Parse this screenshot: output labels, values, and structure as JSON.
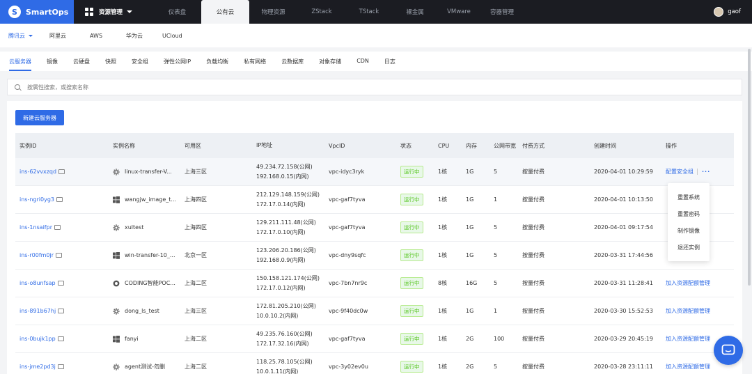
{
  "app": {
    "logo_text": "SmartOps",
    "logo_mark": "S"
  },
  "menu": {
    "label": "资源管理"
  },
  "topnav": [
    "仪表盘",
    "公有云",
    "物理资源",
    "ZStack",
    "TStack",
    "裸金属",
    "VMware",
    "容器管理"
  ],
  "user": {
    "name": "gaof"
  },
  "providers": [
    "腾讯云",
    "阿里云",
    "AWS",
    "华为云",
    "UCloud"
  ],
  "tabs": [
    "云服务器",
    "镜像",
    "云硬盘",
    "快照",
    "安全组",
    "弹性公网IP",
    "负载均衡",
    "私有网络",
    "云数据库",
    "对象存储",
    "CDN",
    "日志"
  ],
  "search": {
    "placeholder": "按属性搜索，或搜索名称"
  },
  "new_button": "新建云服务器",
  "columns": [
    "实例ID",
    "实例名称",
    "可用区",
    "IP地址",
    "VpcID",
    "状态",
    "CPU",
    "内存",
    "公网带宽",
    "付费方式",
    "创建时间",
    "操作"
  ],
  "rows": [
    {
      "id": "ins-62vvxzqd",
      "os": "gear-icon",
      "name": "linux-transfer-V...",
      "zone": "上海三区",
      "ip1": "49.234.72.158(公网)",
      "ip2": "192.168.0.15(内网)",
      "vpc": "vpc-idyc3ryk",
      "status": "运行中",
      "cpu": "1核",
      "mem": "1G",
      "bw": "5",
      "pay": "按量付费",
      "time": "2020-04-01 10:29:59",
      "op": "配置安全组"
    },
    {
      "id": "ins-ngri0yg3",
      "os": "windows-icon",
      "name": "wangjw_image_t...",
      "zone": "上海四区",
      "ip1": "212.129.148.159(公网)",
      "ip2": "172.17.0.14(内网)",
      "vpc": "vpc-gaf7tyva",
      "status": "运行中",
      "cpu": "1核",
      "mem": "1G",
      "bw": "1",
      "pay": "按量付费",
      "time": "2020-04-01 10:13:50",
      "op": ""
    },
    {
      "id": "ins-1nsaifpr",
      "os": "gear-icon",
      "name": "xultest",
      "zone": "上海四区",
      "ip1": "129.211.111.48(公网)",
      "ip2": "172.17.0.10(内网)",
      "vpc": "vpc-gaf7tyva",
      "status": "运行中",
      "cpu": "1核",
      "mem": "1G",
      "bw": "5",
      "pay": "按量付费",
      "time": "2020-04-01 09:17:54",
      "op": ""
    },
    {
      "id": "ins-r00fm0jr",
      "os": "windows-icon",
      "name": "win-transfer-10_...",
      "zone": "北京一区",
      "ip1": "123.206.20.186(公网)",
      "ip2": "192.168.0.9(内网)",
      "vpc": "vpc-dny9sqfc",
      "status": "运行中",
      "cpu": "1核",
      "mem": "1G",
      "bw": "5",
      "pay": "按量付费",
      "time": "2020-03-31 17:44:56",
      "op": ""
    },
    {
      "id": "ins-o8unfsap",
      "os": "coding-icon",
      "name": "CODING智能POC...",
      "zone": "上海二区",
      "ip1": "150.158.121.174(公网)",
      "ip2": "172.17.0.12(内网)",
      "vpc": "vpc-7bn7nr9c",
      "status": "运行中",
      "cpu": "8核",
      "mem": "16G",
      "bw": "5",
      "pay": "按量付费",
      "time": "2020-03-31 11:28:41",
      "op": "加入资源配额管理"
    },
    {
      "id": "ins-891b67hj",
      "os": "gear-icon",
      "name": "dong_ls_test",
      "zone": "上海三区",
      "ip1": "172.81.205.210(公网)",
      "ip2": "10.0.10.2(内网)",
      "vpc": "vpc-9f40dc0w",
      "status": "运行中",
      "cpu": "1核",
      "mem": "1G",
      "bw": "1",
      "pay": "按量付费",
      "time": "2020-03-30 15:52:53",
      "op": "加入资源配额管理"
    },
    {
      "id": "ins-0bujk1pp",
      "os": "windows-icon",
      "name": "fanyi",
      "zone": "上海二区",
      "ip1": "49.235.76.160(公网)",
      "ip2": "172.17.32.16(内网)",
      "vpc": "vpc-gaf7tyva",
      "status": "运行中",
      "cpu": "1核",
      "mem": "2G",
      "bw": "100",
      "pay": "按量付费",
      "time": "2020-03-29 20:45:19",
      "op": "加入资源配额管理"
    },
    {
      "id": "ins-jme2pd3j",
      "os": "gear-icon",
      "name": "agent测试-勿删",
      "zone": "上海二区",
      "ip1": "118.25.78.105(公网)",
      "ip2": "10.0.1.11(内网)",
      "vpc": "vpc-3y02ev0u",
      "status": "运行中",
      "cpu": "1核",
      "mem": "2G",
      "bw": "5",
      "pay": "按量付费",
      "time": "2020-03-28 23:11:11",
      "op": "加入资源配额管理"
    }
  ],
  "dropdown": [
    "重置系统",
    "重置密码",
    "制作镜像",
    "退还实例"
  ],
  "colors": {
    "accent": "#2f6be6",
    "topbar": "#1b1c22",
    "running": "#52c41a"
  }
}
